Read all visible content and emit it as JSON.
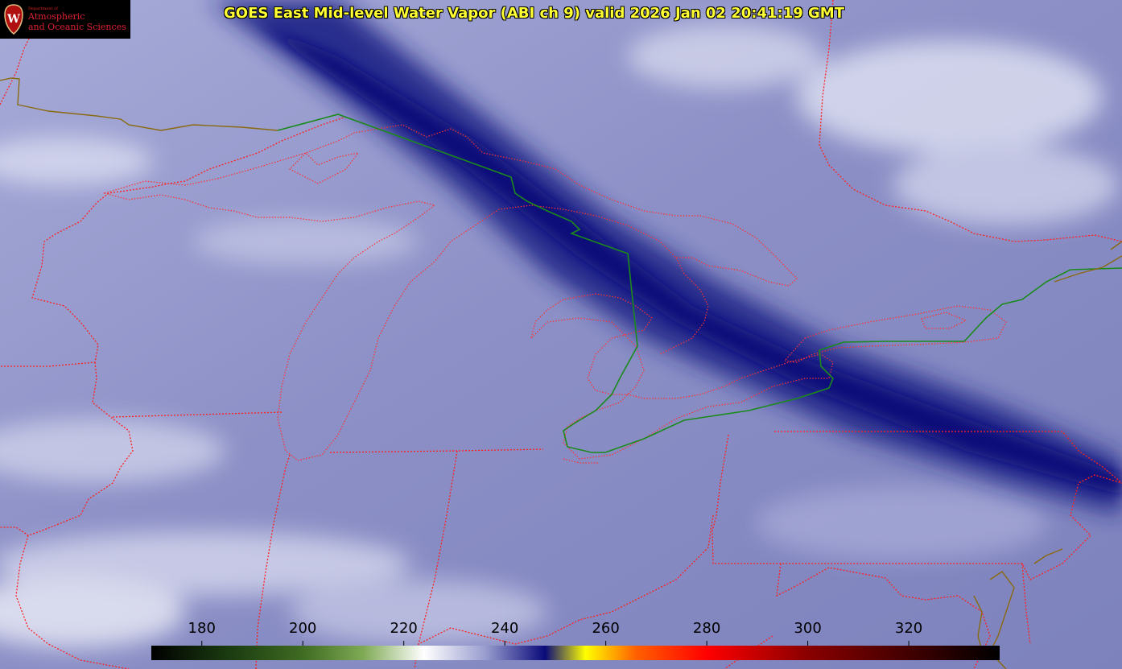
{
  "title": "GOES East Mid-level Water Vapor (ABI ch 9)  valid 2026 Jan 02 20:41:19 GMT",
  "logo": {
    "department_line": "Department of",
    "name_line1": "Atmospheric",
    "name_line2": "and Oceanic Sciences",
    "crest_letter": "W"
  },
  "colorbar": {
    "min": 170,
    "max": 338,
    "ticks": [
      "180",
      "200",
      "220",
      "240",
      "260",
      "280",
      "300",
      "320"
    ],
    "tick_values": [
      180,
      200,
      220,
      240,
      260,
      280,
      300,
      320
    ],
    "stops": [
      {
        "v": 170,
        "c": "#000000"
      },
      {
        "v": 185,
        "c": "#1a3a10"
      },
      {
        "v": 200,
        "c": "#3f6b22"
      },
      {
        "v": 212,
        "c": "#7faa55"
      },
      {
        "v": 224,
        "c": "#ffffff"
      },
      {
        "v": 236,
        "c": "#9a9ecf"
      },
      {
        "v": 248,
        "c": "#0a0a7a"
      },
      {
        "v": 256,
        "c": "#ffff00"
      },
      {
        "v": 266,
        "c": "#ff6000"
      },
      {
        "v": 280,
        "c": "#ff0000"
      },
      {
        "v": 300,
        "c": "#8a0000"
      },
      {
        "v": 338,
        "c": "#000000"
      }
    ]
  },
  "colors": {
    "background": "#8f93c8",
    "moist_band": "#15157a",
    "dry_cloud": "#e6e8f6",
    "state_borders": "#ff2020",
    "international_border": "#1b8a1b",
    "coastline": "#7a6a20"
  }
}
